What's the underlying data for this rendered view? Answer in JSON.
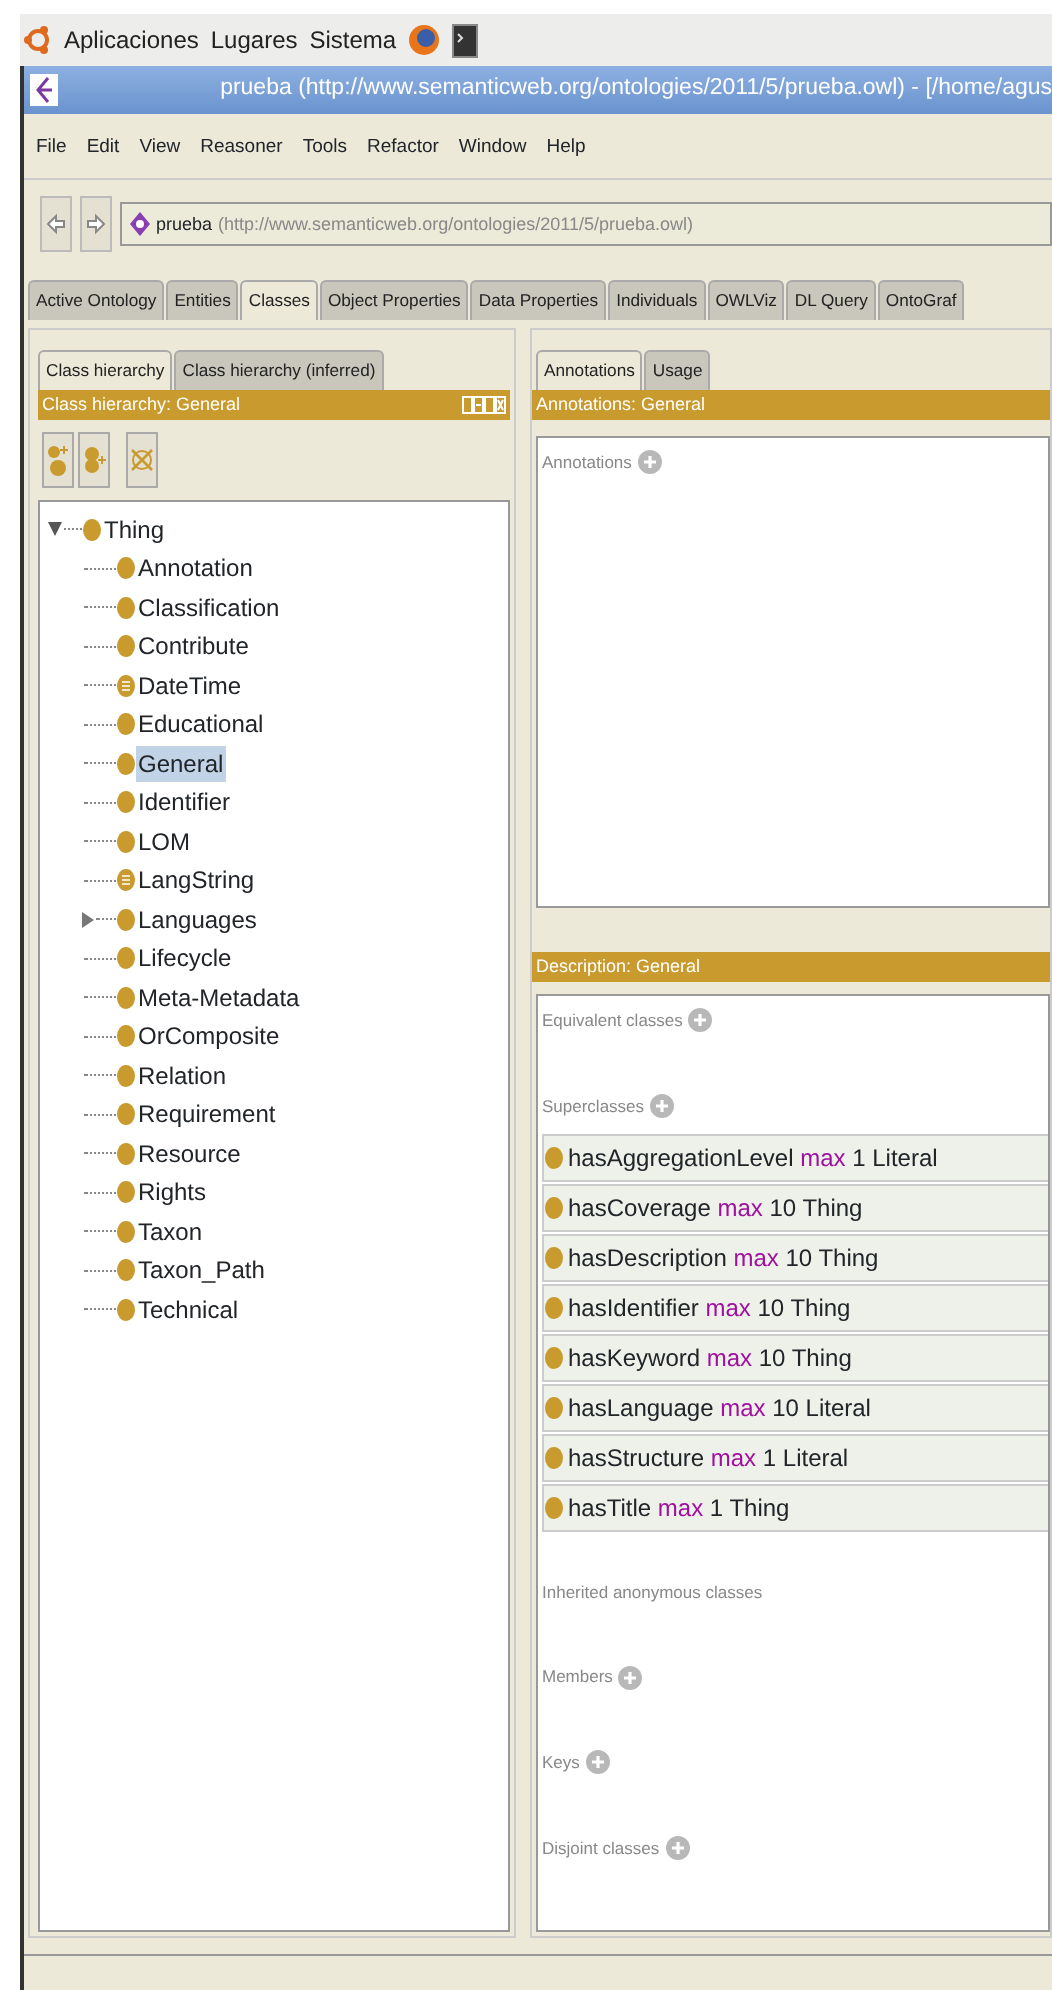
{
  "top_panel": {
    "menus": [
      "Aplicaciones",
      "Lugares",
      "Sistema"
    ]
  },
  "window": {
    "title": "prueba (http://www.semanticweb.org/ontologies/2011/5/prueba.owl) - [/home/agus"
  },
  "menu_bar": [
    "File",
    "Edit",
    "View",
    "Reasoner",
    "Tools",
    "Refactor",
    "Window",
    "Help"
  ],
  "address": {
    "name": "prueba",
    "iri": "(http://www.semanticweb.org/ontologies/2011/5/prueba.owl)"
  },
  "tabs": [
    {
      "label": "Active Ontology",
      "selected": false
    },
    {
      "label": "Entities",
      "selected": false
    },
    {
      "label": "Classes",
      "selected": true
    },
    {
      "label": "Object Properties",
      "selected": false
    },
    {
      "label": "Data Properties",
      "selected": false
    },
    {
      "label": "Individuals",
      "selected": false
    },
    {
      "label": "OWLViz",
      "selected": false
    },
    {
      "label": "DL Query",
      "selected": false
    },
    {
      "label": "OntoGraf",
      "selected": false
    }
  ],
  "left_panel": {
    "tabs": [
      {
        "label": "Class hierarchy",
        "selected": true
      },
      {
        "label": "Class hierarchy (inferred)",
        "selected": false
      }
    ],
    "header": "Class hierarchy: General",
    "tree": [
      {
        "label": "Thing",
        "kind": "class",
        "expanded": true,
        "selected": false,
        "children": [
          {
            "label": "Annotation",
            "kind": "class",
            "selected": false
          },
          {
            "label": "Classification",
            "kind": "class",
            "selected": false
          },
          {
            "label": "Contribute",
            "kind": "class",
            "selected": false
          },
          {
            "label": "DateTime",
            "kind": "defined",
            "selected": false
          },
          {
            "label": "Educational",
            "kind": "class",
            "selected": false
          },
          {
            "label": "General",
            "kind": "class",
            "selected": true
          },
          {
            "label": "Identifier",
            "kind": "class",
            "selected": false
          },
          {
            "label": "LOM",
            "kind": "class",
            "selected": false
          },
          {
            "label": "LangString",
            "kind": "defined",
            "selected": false
          },
          {
            "label": "Languages",
            "kind": "class",
            "expanded": false,
            "selected": false
          },
          {
            "label": "Lifecycle",
            "kind": "class",
            "selected": false
          },
          {
            "label": "Meta-Metadata",
            "kind": "class",
            "selected": false
          },
          {
            "label": "OrComposite",
            "kind": "class",
            "selected": false
          },
          {
            "label": "Relation",
            "kind": "class",
            "selected": false
          },
          {
            "label": "Requirement",
            "kind": "class",
            "selected": false
          },
          {
            "label": "Resource",
            "kind": "class",
            "selected": false
          },
          {
            "label": "Rights",
            "kind": "class",
            "selected": false
          },
          {
            "label": "Taxon",
            "kind": "class",
            "selected": false
          },
          {
            "label": "Taxon_Path",
            "kind": "class",
            "selected": false
          },
          {
            "label": "Technical",
            "kind": "class",
            "selected": false
          }
        ]
      }
    ]
  },
  "right_panel": {
    "tabs": [
      {
        "label": "Annotations",
        "selected": true
      },
      {
        "label": "Usage",
        "selected": false
      }
    ],
    "annotations_header": "Annotations: General",
    "annotations_label": "Annotations",
    "description_header": "Description: General",
    "sections": [
      {
        "label": "Equivalent classes",
        "addable": true
      },
      {
        "label": "Superclasses",
        "addable": true,
        "items": [
          {
            "property": "hasAggregationLevel",
            "keyword": "max",
            "filler": "1 Literal"
          },
          {
            "property": "hasCoverage",
            "keyword": "max",
            "filler": "10 Thing"
          },
          {
            "property": "hasDescription",
            "keyword": "max",
            "filler": "10 Thing"
          },
          {
            "property": "hasIdentifier",
            "keyword": "max",
            "filler": "10 Thing"
          },
          {
            "property": "hasKeyword",
            "keyword": "max",
            "filler": "10 Thing"
          },
          {
            "property": "hasLanguage",
            "keyword": "max",
            "filler": "10 Literal"
          },
          {
            "property": "hasStructure",
            "keyword": "max",
            "filler": "1 Literal"
          },
          {
            "property": "hasTitle",
            "keyword": "max",
            "filler": "1 Thing"
          }
        ]
      },
      {
        "label": "Inherited anonymous classes",
        "addable": false
      },
      {
        "label": "Members",
        "addable": true
      },
      {
        "label": "Keys",
        "addable": true
      },
      {
        "label": "Disjoint classes",
        "addable": true
      }
    ]
  }
}
